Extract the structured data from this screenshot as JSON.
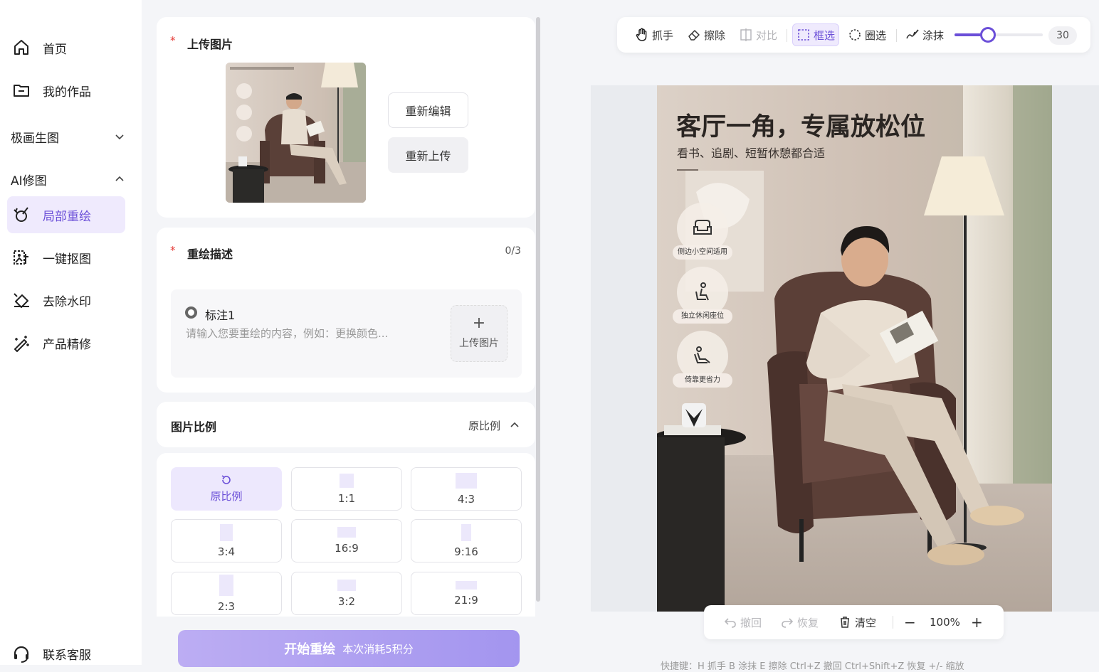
{
  "sidebar": {
    "home": "首页",
    "works": "我的作品",
    "group_jihua": "极画生图",
    "group_ai": "AI修图",
    "items": [
      "局部重绘",
      "一键抠图",
      "去除水印",
      "产品精修"
    ],
    "contact": "联系客服"
  },
  "upload": {
    "title": "上传图片",
    "required_mark": "*",
    "reedit": "重新编辑",
    "reupload": "重新上传"
  },
  "describe": {
    "title": "重绘描述",
    "required_mark": "*",
    "count": "0/3",
    "mark_label": "标注1",
    "placeholder": "请输入您要重绘的内容，例如：更换颜色...",
    "upload_image": "上传图片",
    "plus": "+"
  },
  "ratio": {
    "title": "图片比例",
    "current": "原比例",
    "options": [
      "原比例",
      "1:1",
      "4:3",
      "3:4",
      "16:9",
      "9:16",
      "2:3",
      "3:2",
      "21:9"
    ],
    "selected": "原比例"
  },
  "start": {
    "label": "开始重绘",
    "cost": "本次消耗5积分"
  },
  "toolbar": {
    "tools": [
      "抓手",
      "擦除",
      "对比",
      "框选",
      "圈选",
      "涂抹"
    ],
    "selected_tool": "框选",
    "disabled_tools": [
      "对比"
    ],
    "brush_size": "30",
    "brush_level": 0.38
  },
  "image": {
    "headline": "客厅一角，专属放松位",
    "subline": "看书、追剧、短暂休憩都合适",
    "badges": [
      "侧边小空间适用",
      "独立休闲座位",
      "倚靠更省力"
    ]
  },
  "bottom": {
    "undo": "撤回",
    "redo": "恢复",
    "clear": "清空",
    "zoom": "100%",
    "minus": "−",
    "plus": "+"
  },
  "shortcuts": "快捷键：H 抓手  B 涂抹  E 擦除  Ctrl+Z 撤回  Ctrl+Shift+Z 恢复  +/- 缩放",
  "colors": {
    "accent": "#6b4fd8",
    "accent_light": "#efeafd",
    "required": "#e53935"
  }
}
